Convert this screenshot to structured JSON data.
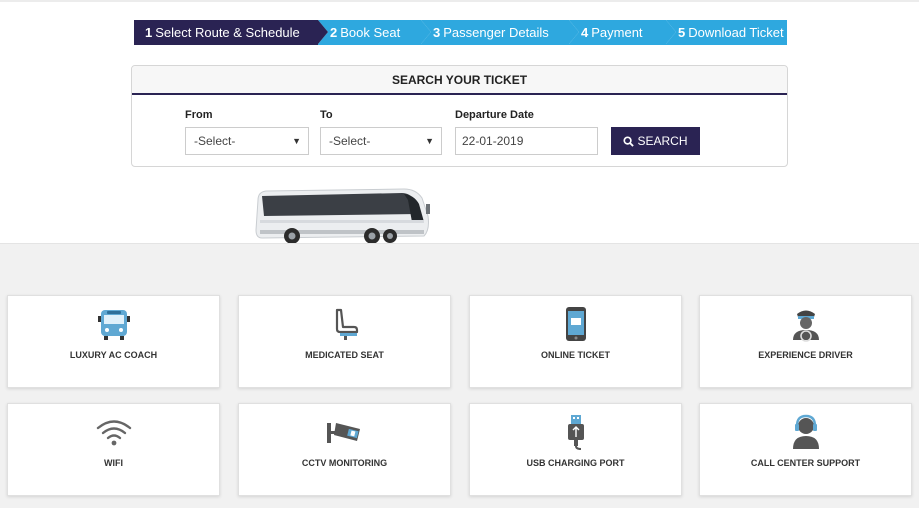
{
  "steps": [
    {
      "num": "1",
      "label": "Select Route & Schedule",
      "active": true
    },
    {
      "num": "2",
      "label": "Book Seat"
    },
    {
      "num": "3",
      "label": "Passenger Details"
    },
    {
      "num": "4",
      "label": "Payment"
    },
    {
      "num": "5",
      "label": "Download Ticket"
    }
  ],
  "search": {
    "title": "SEARCH YOUR TICKET",
    "from_label": "From",
    "from_value": "-Select-",
    "to_label": "To",
    "to_value": "-Select-",
    "date_label": "Departure Date",
    "date_value": "22-01-2019",
    "button_label": "SEARCH"
  },
  "features": [
    {
      "label": "LUXURY AC COACH",
      "icon": "bus-icon"
    },
    {
      "label": "MEDICATED SEAT",
      "icon": "seat-icon"
    },
    {
      "label": "ONLINE TICKET",
      "icon": "mobile-ticket-icon"
    },
    {
      "label": "EXPERIENCE DRIVER",
      "icon": "driver-icon"
    },
    {
      "label": "WIFI",
      "icon": "wifi-icon"
    },
    {
      "label": "CCTV MONITORING",
      "icon": "cctv-icon"
    },
    {
      "label": "USB CHARGING PORT",
      "icon": "usb-icon"
    },
    {
      "label": "CALL CENTER SUPPORT",
      "icon": "headset-icon"
    }
  ],
  "colors": {
    "primary": "#2a2353",
    "accent": "#2ea8df",
    "icon_blue": "#5fa8d3",
    "icon_gray": "#555555"
  }
}
